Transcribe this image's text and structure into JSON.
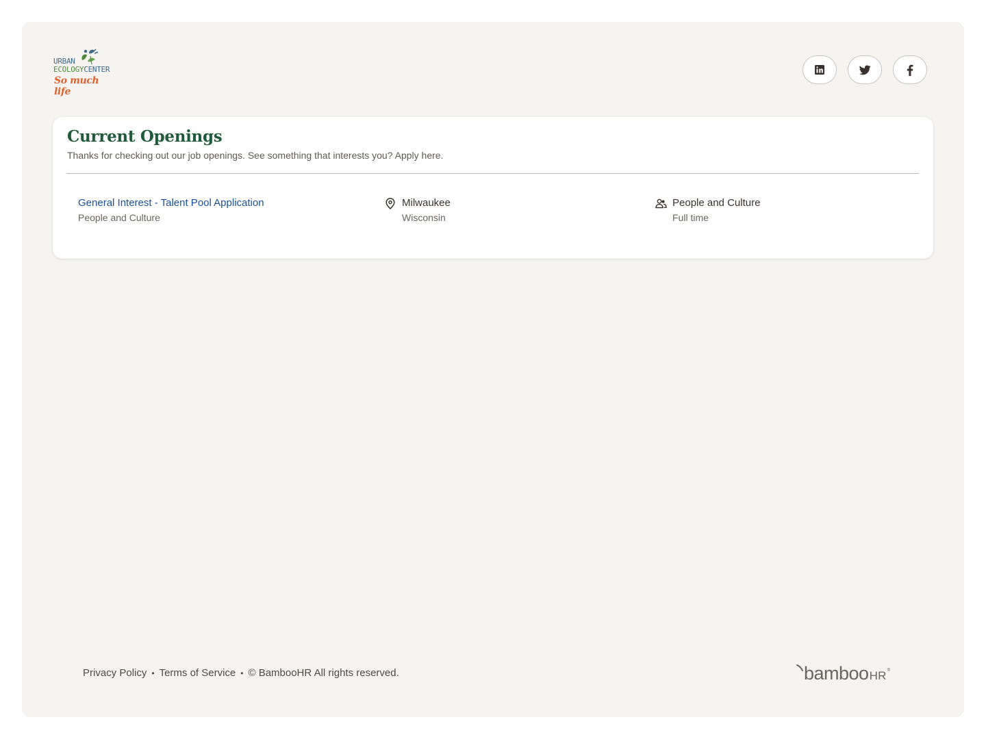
{
  "header": {
    "logo": {
      "line1": "URBAN",
      "line2_part1": "ECOLOGY",
      "line2_part2": "CENTER",
      "tagline": "So much life"
    },
    "social": [
      {
        "name": "linkedin-icon"
      },
      {
        "name": "twitter-icon"
      },
      {
        "name": "facebook-icon"
      }
    ]
  },
  "openings": {
    "title": "Current Openings",
    "subtitle": "Thanks for checking out our job openings. See something that interests you? Apply here.",
    "jobs": [
      {
        "title": "General Interest - Talent Pool Application",
        "department": "People and Culture",
        "city": "Milwaukee",
        "state": "Wisconsin",
        "team": "People and Culture",
        "employment_type": "Full time"
      }
    ]
  },
  "footer": {
    "privacy": "Privacy Policy",
    "terms": "Terms of Service",
    "copyright": "© BambooHR All rights reserved.",
    "brand": "bamboo",
    "brand_suffix": "HR",
    "brand_reg": "®"
  },
  "colors": {
    "frame_bg": "#f5f4f1",
    "heading_green": "#1f5a3a",
    "link_blue": "#1a4f9c",
    "logo_orange": "#e0622f"
  }
}
